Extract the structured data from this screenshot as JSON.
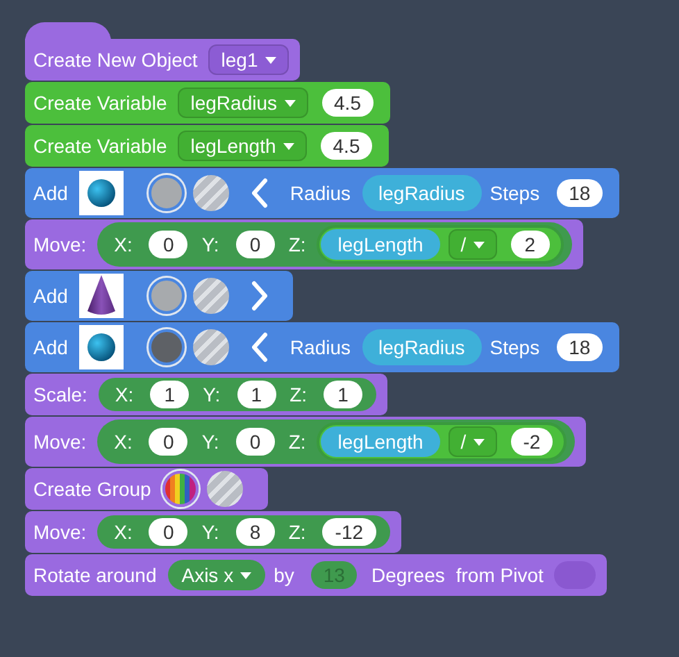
{
  "blocks": [
    {
      "kind": "object",
      "parts": [
        {
          "kind": "text",
          "text": "Create New Object"
        },
        {
          "kind": "dropdown",
          "text": "leg1"
        }
      ]
    },
    {
      "kind": "variable",
      "parts": [
        {
          "kind": "text",
          "text": "Create Variable"
        },
        {
          "kind": "dropdown",
          "text": "legRadius"
        },
        {
          "kind": "number",
          "text": "4.5"
        }
      ]
    },
    {
      "kind": "variable",
      "parts": [
        {
          "kind": "text",
          "text": "Create Variable"
        },
        {
          "kind": "dropdown",
          "text": "legLength"
        },
        {
          "kind": "number",
          "text": "4.5"
        }
      ]
    },
    {
      "kind": "add",
      "parts": [
        {
          "kind": "text",
          "text": "Add"
        },
        {
          "kind": "sphere"
        },
        {
          "kind": "swatch",
          "color": "#a7aaad"
        },
        {
          "kind": "texture"
        },
        {
          "kind": "toggle",
          "expanded": true
        },
        {
          "kind": "text",
          "text": "Radius"
        },
        {
          "kind": "variable",
          "text": "legRadius"
        },
        {
          "kind": "text",
          "text": "Steps"
        },
        {
          "kind": "number",
          "text": "18"
        }
      ]
    },
    {
      "kind": "transform",
      "parts": [
        {
          "kind": "text",
          "text": "Move:"
        },
        {
          "kind": "vector",
          "parts": [
            {
              "kind": "text",
              "text": "X:"
            },
            {
              "kind": "number",
              "text": "0"
            },
            {
              "kind": "text",
              "text": "Y:"
            },
            {
              "kind": "number",
              "text": "0"
            },
            {
              "kind": "text",
              "text": "Z:"
            },
            {
              "kind": "expression",
              "parts": [
                {
                  "kind": "variable",
                  "text": "legLength"
                },
                {
                  "kind": "dropdown",
                  "text": "/"
                },
                {
                  "kind": "number",
                  "text": "2"
                }
              ]
            }
          ]
        }
      ]
    },
    {
      "kind": "add",
      "parts": [
        {
          "kind": "text",
          "text": "Add"
        },
        {
          "kind": "cone"
        },
        {
          "kind": "swatch",
          "color": "#a7aaad"
        },
        {
          "kind": "texture"
        },
        {
          "kind": "toggle",
          "expanded": false
        }
      ]
    },
    {
      "kind": "add",
      "parts": [
        {
          "kind": "text",
          "text": "Add"
        },
        {
          "kind": "sphere"
        },
        {
          "kind": "swatch",
          "color": "#5e6166"
        },
        {
          "kind": "texture"
        },
        {
          "kind": "toggle",
          "expanded": true
        },
        {
          "kind": "text",
          "text": "Radius"
        },
        {
          "kind": "variable",
          "text": "legRadius"
        },
        {
          "kind": "text",
          "text": "Steps"
        },
        {
          "kind": "number",
          "text": "18"
        }
      ]
    },
    {
      "kind": "transform",
      "parts": [
        {
          "kind": "text",
          "text": "Scale:"
        },
        {
          "kind": "vector",
          "parts": [
            {
              "kind": "text",
              "text": "X:"
            },
            {
              "kind": "number",
              "text": "1"
            },
            {
              "kind": "text",
              "text": "Y:"
            },
            {
              "kind": "number",
              "text": "1"
            },
            {
              "kind": "text",
              "text": "Z:"
            },
            {
              "kind": "number",
              "text": "1"
            }
          ]
        }
      ]
    },
    {
      "kind": "transform",
      "parts": [
        {
          "kind": "text",
          "text": "Move:"
        },
        {
          "kind": "vector",
          "parts": [
            {
              "kind": "text",
              "text": "X:"
            },
            {
              "kind": "number",
              "text": "0"
            },
            {
              "kind": "text",
              "text": "Y:"
            },
            {
              "kind": "number",
              "text": "0"
            },
            {
              "kind": "text",
              "text": "Z:"
            },
            {
              "kind": "expression",
              "parts": [
                {
                  "kind": "variable",
                  "text": "legLength"
                },
                {
                  "kind": "dropdown",
                  "text": "/"
                },
                {
                  "kind": "number",
                  "text": "-2"
                }
              ]
            }
          ]
        }
      ]
    },
    {
      "kind": "transform",
      "parts": [
        {
          "kind": "text",
          "text": "Create Group"
        },
        {
          "kind": "palette"
        },
        {
          "kind": "texture"
        }
      ]
    },
    {
      "kind": "transform",
      "parts": [
        {
          "kind": "text",
          "text": "Move:"
        },
        {
          "kind": "vector",
          "parts": [
            {
              "kind": "text",
              "text": "X:"
            },
            {
              "kind": "number",
              "text": "0"
            },
            {
              "kind": "text",
              "text": "Y:"
            },
            {
              "kind": "number",
              "text": "8"
            },
            {
              "kind": "text",
              "text": "Z:"
            },
            {
              "kind": "number",
              "text": "-12"
            }
          ]
        }
      ]
    },
    {
      "kind": "transform",
      "parts": [
        {
          "kind": "text",
          "text": "Rotate around"
        },
        {
          "kind": "choice",
          "text": "Axis x"
        },
        {
          "kind": "text",
          "text": "by"
        },
        {
          "kind": "number",
          "text": "13",
          "disabled": true
        },
        {
          "kind": "text",
          "text": "Degrees"
        },
        {
          "kind": "text",
          "text": "from Pivot"
        },
        {
          "kind": "slot"
        }
      ]
    }
  ]
}
